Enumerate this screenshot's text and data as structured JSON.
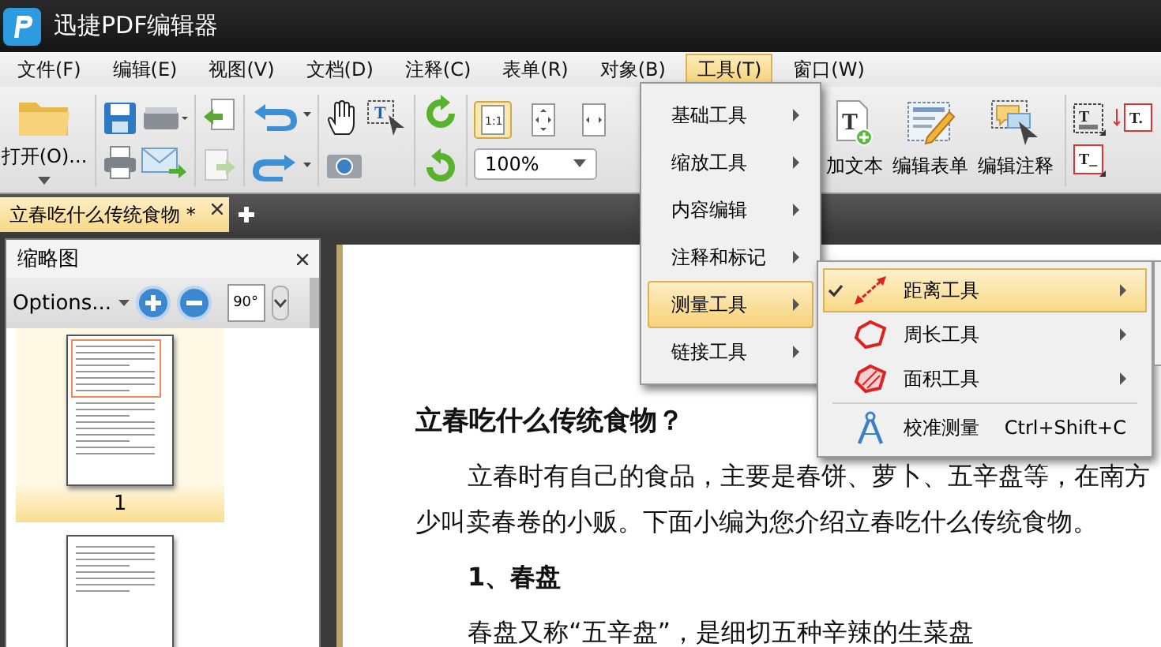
{
  "window": {
    "title": "迅捷PDF编辑器"
  },
  "menu_bar": [
    {
      "label": "文件(F)",
      "selected": false
    },
    {
      "label": "编辑(E)",
      "selected": false
    },
    {
      "label": "视图(V)",
      "selected": false
    },
    {
      "label": "文档(D)",
      "selected": false
    },
    {
      "label": "注释(C)",
      "selected": false
    },
    {
      "label": "表单(R)",
      "selected": false
    },
    {
      "label": "对象(B)",
      "selected": false
    },
    {
      "label": "工具(T)",
      "selected": true
    },
    {
      "label": "窗口(W)",
      "selected": false
    }
  ],
  "toolbar": {
    "open_label": "打开(O)...",
    "zoom_value": "100%",
    "actual_size_label": "1:1",
    "select_glyph": "T",
    "text_tool_glyphs": [
      "T",
      "T.",
      "T_"
    ],
    "buttons": [
      {
        "label": "加文本",
        "kind": "text",
        "glyph": "T"
      },
      {
        "label": "编辑表单",
        "kind": "form"
      },
      {
        "label": "编辑注释",
        "kind": "comment"
      }
    ]
  },
  "document_tabs": [
    {
      "label": "立春吃什么传统食物 *",
      "selected": true
    }
  ],
  "thumbnails_panel": {
    "title": "缩略图",
    "options": "Options...",
    "rotate_label": "90°",
    "pages": [
      {
        "number": "1",
        "selected": true
      },
      {
        "selected": false
      }
    ]
  },
  "document": {
    "heading": "立春吃什么传统食物？",
    "paragraph_lines": [
      "立春时有自己的食品，主要是春饼、萝卜、五辛盘等，在南方",
      "少叫卖春卷的小贩。下面小编为您介绍立春吃什么传统食物。"
    ],
    "subheading": "1、春盘",
    "last_line": "春盘又称“五辛盘”，是细切五种辛辣的生菜盘"
  },
  "tools_menu": [
    {
      "label": "基础工具",
      "selected": false
    },
    {
      "label": "缩放工具",
      "selected": false
    },
    {
      "label": "内容编辑",
      "selected": false
    },
    {
      "label": "注释和标记",
      "selected": false
    },
    {
      "label": "测量工具",
      "selected": true
    },
    {
      "label": "链接工具",
      "selected": false
    }
  ],
  "measure_submenu": [
    {
      "label": "距离工具",
      "kind": "distance",
      "checked": true,
      "selected": true,
      "has_submenu": true
    },
    {
      "label": "周长工具",
      "kind": "perimeter",
      "checked": false,
      "selected": false,
      "has_submenu": true
    },
    {
      "label": "面积工具",
      "kind": "area",
      "checked": false,
      "selected": false,
      "has_submenu": true
    },
    {
      "label": "校准测量",
      "kind": "calibrate",
      "checked": false,
      "selected": false,
      "has_submenu": false,
      "shortcut": "Ctrl+Shift+C"
    }
  ]
}
